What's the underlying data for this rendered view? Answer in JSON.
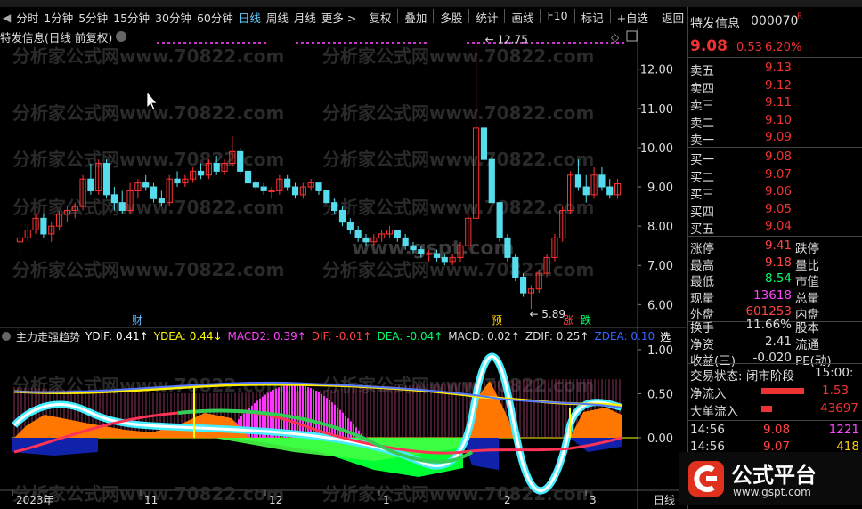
{
  "menu": {
    "tabs": [
      "分时",
      "1分钟",
      "5分钟",
      "15分钟",
      "30分钟",
      "60分钟",
      "日线",
      "周线",
      "月线",
      "更多 >"
    ],
    "active": "日线",
    "tools": [
      "复权",
      "叠加",
      "多股",
      "统计",
      "画线",
      "F10",
      "标记",
      "+自选",
      "返回"
    ]
  },
  "chart_header": "特发信息(日线 前复权)",
  "indicator": {
    "name": "主力走强趋势",
    "items": [
      {
        "text": "YDIF: 0.41↑",
        "color": "#ffffff"
      },
      {
        "text": "YDEA: 0.44↓",
        "color": "#ffff00"
      },
      {
        "text": "MACD2: 0.39↑",
        "color": "#ff44ff"
      },
      {
        "text": "DIF: -0.01↑",
        "color": "#ff4444"
      },
      {
        "text": "DEA: -0.04↑",
        "color": "#00ff66"
      },
      {
        "text": "MACD: 0.02↑",
        "color": "#dddddd"
      },
      {
        "text": "ZDIF: 0.25↑",
        "color": "#dddddd"
      },
      {
        "text": "ZDEA: 0.10",
        "color": "#3366ff"
      },
      {
        "text": "选",
        "color": "#ffffff"
      }
    ]
  },
  "chart_data": {
    "type": "candlestick",
    "price_ylim": [
      5.6,
      12.9
    ],
    "price_ticks": [
      "12.00",
      "11.00",
      "10.00",
      "9.00",
      "8.00",
      "7.00",
      "6.00"
    ],
    "max_label": "12.75",
    "min_label": "5.89",
    "osc_ticks": [
      "1.00",
      "0.50",
      "0.00"
    ],
    "x_labels": [
      "2023年",
      "11",
      "12",
      "1",
      "2",
      "3"
    ],
    "period_label": "日线",
    "markers": [
      {
        "text": "财",
        "color": "#66bbff"
      },
      {
        "text": "预",
        "color": "#ffcc00"
      },
      {
        "text": "涨",
        "color": "#ff4444"
      },
      {
        "text": "跌",
        "color": "#00ff66"
      }
    ],
    "candles": [
      [
        7.6,
        7.9,
        7.3,
        7.7
      ],
      [
        7.7,
        8.0,
        7.6,
        7.9
      ],
      [
        7.9,
        8.3,
        7.8,
        8.2
      ],
      [
        8.2,
        8.3,
        7.7,
        7.8
      ],
      [
        7.8,
        8.1,
        7.6,
        8.0
      ],
      [
        8.0,
        8.4,
        7.9,
        8.3
      ],
      [
        8.3,
        8.5,
        8.1,
        8.4
      ],
      [
        8.4,
        8.6,
        8.2,
        8.5
      ],
      [
        8.5,
        9.3,
        8.4,
        9.2
      ],
      [
        9.2,
        9.6,
        8.8,
        8.9
      ],
      [
        8.9,
        9.7,
        8.8,
        9.6
      ],
      [
        9.6,
        9.7,
        8.7,
        8.8
      ],
      [
        8.8,
        9.0,
        8.4,
        8.6
      ],
      [
        8.6,
        8.9,
        8.3,
        8.4
      ],
      [
        8.4,
        9.1,
        8.3,
        8.9
      ],
      [
        8.9,
        9.2,
        8.7,
        9.1
      ],
      [
        9.1,
        9.3,
        8.9,
        9.0
      ],
      [
        9.0,
        9.1,
        8.6,
        8.7
      ],
      [
        8.7,
        8.9,
        8.5,
        8.6
      ],
      [
        8.6,
        9.3,
        8.5,
        9.2
      ],
      [
        9.2,
        9.4,
        9.0,
        9.1
      ],
      [
        9.1,
        9.3,
        9.0,
        9.2
      ],
      [
        9.2,
        9.5,
        9.1,
        9.4
      ],
      [
        9.4,
        9.6,
        9.2,
        9.3
      ],
      [
        9.3,
        9.7,
        9.2,
        9.6
      ],
      [
        9.6,
        9.8,
        9.3,
        9.4
      ],
      [
        9.4,
        9.7,
        9.3,
        9.6
      ],
      [
        9.6,
        10.3,
        9.5,
        9.9
      ],
      [
        9.9,
        10.0,
        9.3,
        9.4
      ],
      [
        9.4,
        9.5,
        9.0,
        9.1
      ],
      [
        9.1,
        9.2,
        8.9,
        9.0
      ],
      [
        9.0,
        9.1,
        8.8,
        8.9
      ],
      [
        8.9,
        9.0,
        8.7,
        8.9
      ],
      [
        8.9,
        9.3,
        8.8,
        9.2
      ],
      [
        9.2,
        9.3,
        8.9,
        9.0
      ],
      [
        9.0,
        9.1,
        8.7,
        8.8
      ],
      [
        8.8,
        9.1,
        8.7,
        9.0
      ],
      [
        9.0,
        9.2,
        8.9,
        9.1
      ],
      [
        9.1,
        9.1,
        8.8,
        8.9
      ],
      [
        8.9,
        8.9,
        8.6,
        8.6
      ],
      [
        8.6,
        8.7,
        8.3,
        8.4
      ],
      [
        8.4,
        8.5,
        8.0,
        8.1
      ],
      [
        8.1,
        8.2,
        7.8,
        7.9
      ],
      [
        7.9,
        8.0,
        7.6,
        7.7
      ],
      [
        7.7,
        7.8,
        7.5,
        7.6
      ],
      [
        7.6,
        7.8,
        7.5,
        7.7
      ],
      [
        7.7,
        7.9,
        7.6,
        7.8
      ],
      [
        7.8,
        8.0,
        7.7,
        7.9
      ],
      [
        7.9,
        7.9,
        7.6,
        7.7
      ],
      [
        7.7,
        7.8,
        7.4,
        7.5
      ],
      [
        7.5,
        7.6,
        7.3,
        7.4
      ],
      [
        7.4,
        7.5,
        7.2,
        7.3
      ],
      [
        7.3,
        7.4,
        7.1,
        7.3
      ],
      [
        7.3,
        7.4,
        7.1,
        7.2
      ],
      [
        7.2,
        7.3,
        7.0,
        7.1
      ],
      [
        7.1,
        7.3,
        7.0,
        7.2
      ],
      [
        7.2,
        7.6,
        7.1,
        7.5
      ],
      [
        7.5,
        8.3,
        7.4,
        8.2
      ],
      [
        8.2,
        12.75,
        8.1,
        10.5
      ],
      [
        10.5,
        10.6,
        9.6,
        9.7
      ],
      [
        9.7,
        9.8,
        8.6,
        8.6
      ],
      [
        8.6,
        8.6,
        7.6,
        7.7
      ],
      [
        7.7,
        7.8,
        7.1,
        7.2
      ],
      [
        7.2,
        7.3,
        6.6,
        6.7
      ],
      [
        6.7,
        6.8,
        6.2,
        6.3
      ],
      [
        6.3,
        6.5,
        5.89,
        6.4
      ],
      [
        6.4,
        6.9,
        6.3,
        6.8
      ],
      [
        6.8,
        7.3,
        6.7,
        7.2
      ],
      [
        7.2,
        7.8,
        7.1,
        7.7
      ],
      [
        7.7,
        8.5,
        7.6,
        8.4
      ],
      [
        8.4,
        9.4,
        8.3,
        9.3
      ],
      [
        9.3,
        9.7,
        8.9,
        9.0
      ],
      [
        9.0,
        9.3,
        8.6,
        8.8
      ],
      [
        8.8,
        9.5,
        8.7,
        9.3
      ],
      [
        9.3,
        9.5,
        8.9,
        9.0
      ],
      [
        9.0,
        9.2,
        8.7,
        8.8
      ],
      [
        8.8,
        9.2,
        8.7,
        9.08
      ]
    ]
  },
  "quote": {
    "name": "特发信息",
    "code": "000070",
    "price": "9.08",
    "change": "0.53",
    "pct": "6.20%",
    "sell": [
      {
        "label": "卖五",
        "price": "9.13"
      },
      {
        "label": "卖四",
        "price": "9.12"
      },
      {
        "label": "卖三",
        "price": "9.11"
      },
      {
        "label": "卖二",
        "price": "9.10"
      },
      {
        "label": "卖一",
        "price": "9.09"
      }
    ],
    "buy": [
      {
        "label": "买一",
        "price": "9.08"
      },
      {
        "label": "买二",
        "price": "9.07"
      },
      {
        "label": "买三",
        "price": "9.06"
      },
      {
        "label": "买四",
        "price": "9.05"
      },
      {
        "label": "买五",
        "price": "9.04"
      }
    ],
    "stats": [
      {
        "l": "涨停",
        "v": "9.41",
        "c": "#ff4444",
        "l2": "跌停"
      },
      {
        "l": "最高",
        "v": "9.18",
        "c": "#ff4444",
        "l2": "量比"
      },
      {
        "l": "最低",
        "v": "8.54",
        "c": "#00ff66",
        "l2": "市值"
      },
      {
        "l": "现量",
        "v": "13618",
        "c": "#ff44ff",
        "l2": "总量"
      },
      {
        "l": "外盘",
        "v": "601253",
        "c": "#ff4444",
        "l2": "内盘"
      }
    ],
    "stats2": [
      {
        "l": "换手",
        "v": "11.66%",
        "c": "#dddddd",
        "l2": "股本"
      },
      {
        "l": "净资",
        "v": "2.41",
        "c": "#dddddd",
        "l2": "流通"
      },
      {
        "l": "收益(三)",
        "v": "-0.020",
        "c": "#dddddd",
        "l2": "PE(动)"
      }
    ],
    "trade_status": "交易状态: 闭市阶段",
    "trade_time": "15:00:",
    "net_flow": {
      "label": "净流入",
      "value": "1.53"
    },
    "big_flow": {
      "label": "大单流入",
      "value": "43697"
    },
    "ticks": [
      {
        "time": "14:56",
        "price": "9.08",
        "vol": "1221",
        "pc": "#ff4444",
        "vc": "#ff44ff"
      },
      {
        "time": "14:56",
        "price": "9.07",
        "vol": "418",
        "pc": "#ff4444",
        "vc": "#ffcc00"
      }
    ]
  },
  "watermark": "分析家公式网www.70822.com",
  "watermark2": "www.gspt.com",
  "logo": {
    "text": "公式平台",
    "url": "www.gspt.com"
  }
}
